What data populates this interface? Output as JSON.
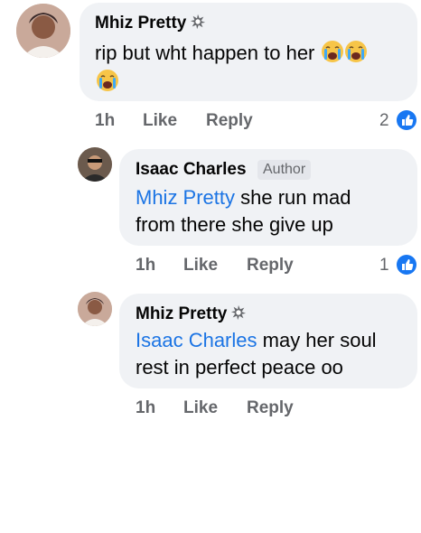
{
  "comments": [
    {
      "name": "Mhiz Pretty",
      "text": "rip but wht happen to her",
      "time": "1h",
      "like_label": "Like",
      "reply_label": "Reply",
      "reaction_count": "2"
    },
    {
      "name": "Isaac Charles",
      "author_badge": "Author",
      "mention": "Mhiz Pretty",
      "text_line1": " she run mad",
      "text_line2": "from there she give up",
      "time": "1h",
      "like_label": "Like",
      "reply_label": "Reply",
      "reaction_count": "1"
    },
    {
      "name": "Mhiz Pretty",
      "mention": "Isaac Charles",
      "text_line1": " may her soul",
      "text_line2": "rest in perfect peace oo",
      "time": "1h",
      "like_label": "Like",
      "reply_label": "Reply"
    }
  ],
  "colors": {
    "link": "#1b74e4",
    "bubble": "#f0f2f5",
    "meta": "#65676b",
    "like_blue": "#1877f2"
  },
  "icons": [
    "top-fan-badge-icon",
    "crying-emoji-icon",
    "like-reaction-icon"
  ]
}
